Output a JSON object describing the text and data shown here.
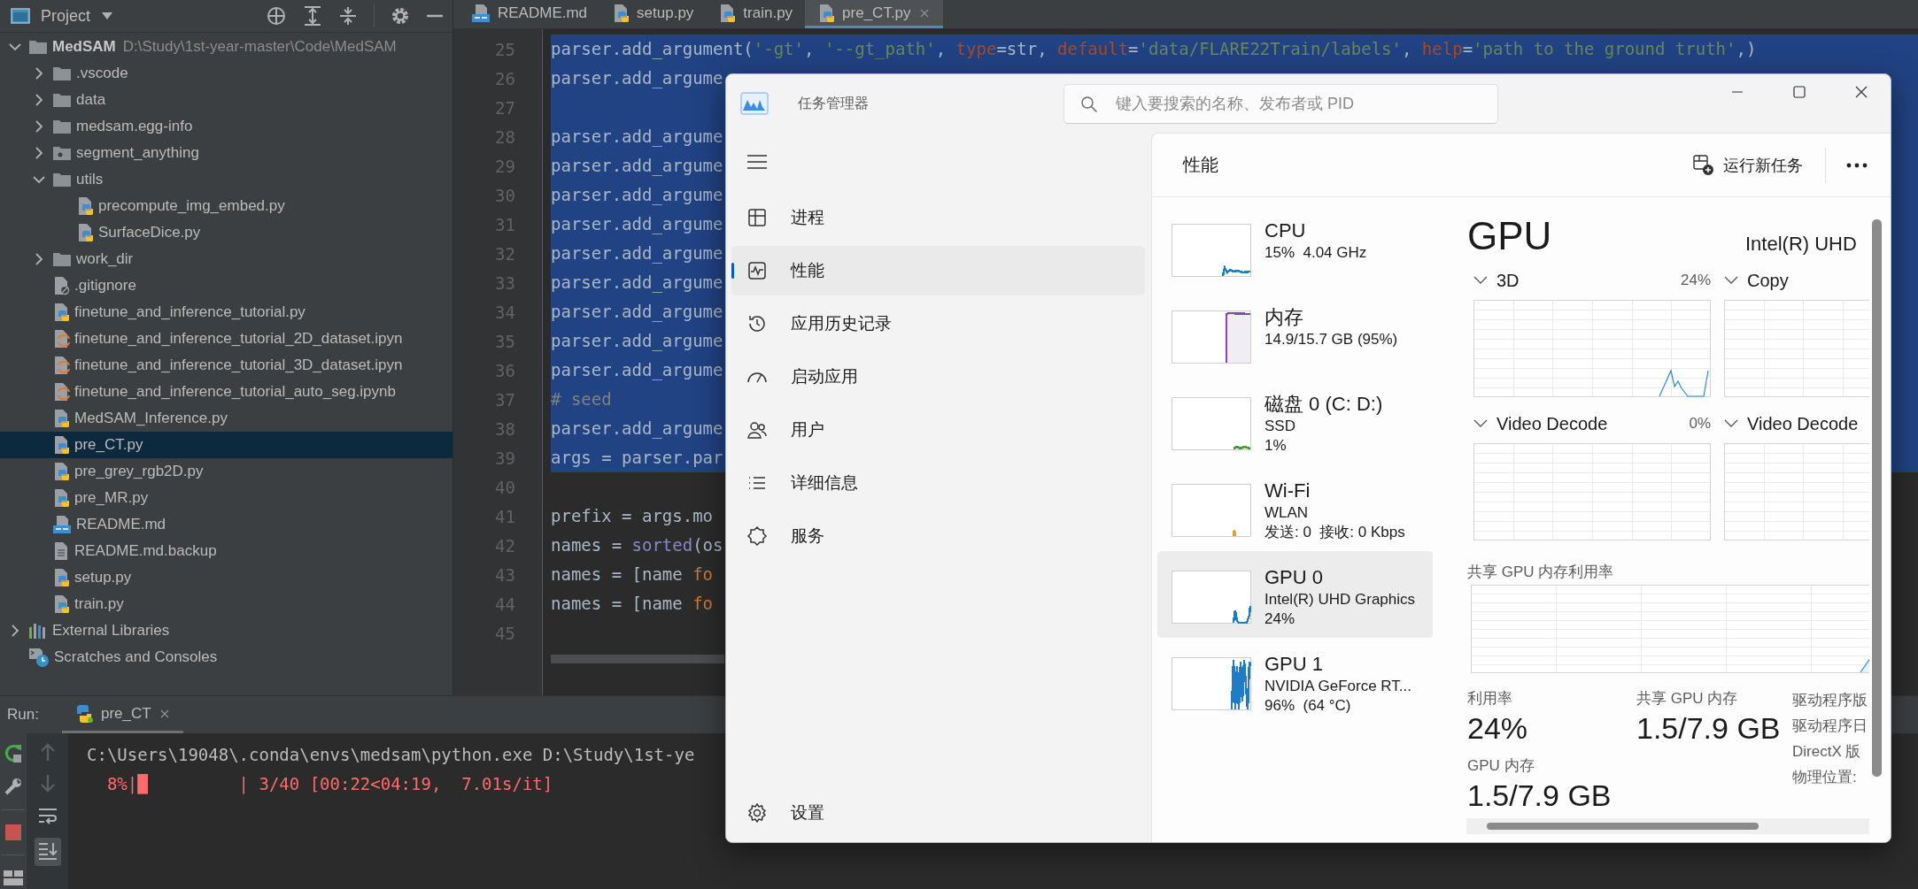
{
  "ide": {
    "project_panel": {
      "title": "Project",
      "tree": [
        {
          "label": "MedSAM",
          "path": "D:\\Study\\1st-year-master\\Code\\MedSAM",
          "kind": "folder",
          "expanded": true,
          "selected": false,
          "children": [
            {
              "label": ".vscode",
              "kind": "folder",
              "expanded": false,
              "selected": false
            },
            {
              "label": "data",
              "kind": "folder",
              "expanded": false,
              "selected": false
            },
            {
              "label": "medsam.egg-info",
              "kind": "folder",
              "expanded": false,
              "selected": false
            },
            {
              "label": "segment_anything",
              "kind": "package",
              "expanded": false,
              "selected": false
            },
            {
              "label": "utils",
              "kind": "folder",
              "expanded": true,
              "selected": false,
              "children": [
                {
                  "label": "precompute_img_embed.py",
                  "kind": "python",
                  "selected": false
                },
                {
                  "label": "SurfaceDice.py",
                  "kind": "python",
                  "selected": false
                }
              ]
            },
            {
              "label": "work_dir",
              "kind": "folder",
              "expanded": false,
              "selected": false
            },
            {
              "label": ".gitignore",
              "kind": "ignore",
              "selected": false
            },
            {
              "label": "finetune_and_inference_tutorial.py",
              "kind": "python",
              "selected": false
            },
            {
              "label": "finetune_and_inference_tutorial_2D_dataset.ipyn",
              "kind": "notebook",
              "selected": false
            },
            {
              "label": "finetune_and_inference_tutorial_3D_dataset.ipyn",
              "kind": "notebook",
              "selected": false
            },
            {
              "label": "finetune_and_inference_tutorial_auto_seg.ipynb",
              "kind": "notebook",
              "selected": false
            },
            {
              "label": "MedSAM_Inference.py",
              "kind": "python",
              "selected": false
            },
            {
              "label": "pre_CT.py",
              "kind": "python",
              "selected": true
            },
            {
              "label": "pre_grey_rgb2D.py",
              "kind": "python",
              "selected": false
            },
            {
              "label": "pre_MR.py",
              "kind": "python",
              "selected": false
            },
            {
              "label": "README.md",
              "kind": "markdown",
              "selected": false
            },
            {
              "label": "README.md.backup",
              "kind": "text",
              "selected": false
            },
            {
              "label": "setup.py",
              "kind": "python",
              "selected": false
            },
            {
              "label": "train.py",
              "kind": "python",
              "selected": false
            }
          ]
        },
        {
          "label": "External Libraries",
          "kind": "libraries",
          "expanded": false,
          "selected": false
        },
        {
          "label": "Scratches and Consoles",
          "kind": "scratches",
          "selected": false
        }
      ]
    },
    "editor": {
      "tabs": [
        {
          "label": "README.md",
          "kind": "markdown",
          "selected": false
        },
        {
          "label": "setup.py",
          "kind": "python",
          "selected": false
        },
        {
          "label": "train.py",
          "kind": "python",
          "selected": false
        },
        {
          "label": "pre_CT.py",
          "kind": "python",
          "selected": true
        }
      ],
      "lines": [
        {
          "number": "25",
          "selected": true,
          "tokens": [
            {
              "kind": "plain",
              "text": "parser.add_argument("
            },
            {
              "kind": "string",
              "text": "'-gt'"
            },
            {
              "kind": "plain",
              "text": ", "
            },
            {
              "kind": "string",
              "text": "'--gt_path'"
            },
            {
              "kind": "plain",
              "text": ", "
            },
            {
              "kind": "param",
              "text": "type"
            },
            {
              "kind": "plain",
              "text": "=str, "
            },
            {
              "kind": "param",
              "text": "default"
            },
            {
              "kind": "plain",
              "text": "="
            },
            {
              "kind": "string",
              "text": "'data/FLARE22Train/labels'"
            },
            {
              "kind": "plain",
              "text": ", "
            },
            {
              "kind": "param",
              "text": "help"
            },
            {
              "kind": "plain",
              "text": "="
            },
            {
              "kind": "string",
              "text": "'path to the ground truth'"
            },
            {
              "kind": "plain",
              "text": ",)"
            }
          ]
        },
        {
          "number": "26",
          "selected": true,
          "tokens": [
            {
              "kind": "plain",
              "text": "parser.add_argume"
            }
          ]
        },
        {
          "number": "27",
          "selected": true
        },
        {
          "number": "28",
          "selected": true,
          "tokens": [
            {
              "kind": "plain",
              "text": "parser.add_argume"
            }
          ]
        },
        {
          "number": "29",
          "selected": true,
          "tokens": [
            {
              "kind": "plain",
              "text": "parser.add_argume"
            }
          ]
        },
        {
          "number": "30",
          "selected": true,
          "tokens": [
            {
              "kind": "plain",
              "text": "parser.add_argume"
            }
          ]
        },
        {
          "number": "31",
          "selected": true,
          "tokens": [
            {
              "kind": "plain",
              "text": "parser.add_argume"
            }
          ]
        },
        {
          "number": "32",
          "selected": true,
          "tokens": [
            {
              "kind": "plain",
              "text": "parser.add_argume"
            }
          ]
        },
        {
          "number": "33",
          "selected": true,
          "tokens": [
            {
              "kind": "plain",
              "text": "parser.add_argume"
            }
          ]
        },
        {
          "number": "34",
          "selected": true,
          "tokens": [
            {
              "kind": "plain",
              "text": "parser.add_argume"
            }
          ]
        },
        {
          "number": "35",
          "selected": true,
          "tokens": [
            {
              "kind": "plain",
              "text": "parser.add_argume"
            }
          ]
        },
        {
          "number": "36",
          "selected": true,
          "tokens": [
            {
              "kind": "plain",
              "text": "parser.add_argume"
            }
          ]
        },
        {
          "number": "37",
          "selected": true,
          "tokens": [
            {
              "kind": "comment",
              "text": "# seed"
            }
          ]
        },
        {
          "number": "38",
          "selected": true,
          "tokens": [
            {
              "kind": "plain",
              "text": "parser.add_argume"
            }
          ]
        },
        {
          "number": "39",
          "selected": true,
          "tokens": [
            {
              "kind": "plain",
              "text": "args = parser.par"
            }
          ]
        },
        {
          "number": "40",
          "selected": false
        },
        {
          "number": "41",
          "selected": false,
          "tokens": [
            {
              "kind": "plain",
              "text": "prefix = args.mo"
            }
          ]
        },
        {
          "number": "42",
          "selected": false,
          "tokens": [
            {
              "kind": "plain",
              "text": "names = "
            },
            {
              "kind": "builtin",
              "text": "sorted"
            },
            {
              "kind": "plain",
              "text": "(os"
            }
          ]
        },
        {
          "number": "43",
          "selected": false,
          "tokens": [
            {
              "kind": "plain",
              "text": "names = [name "
            },
            {
              "kind": "keyword",
              "text": "fo"
            }
          ]
        },
        {
          "number": "44",
          "selected": false,
          "tokens": [
            {
              "kind": "plain",
              "text": "names = [name "
            },
            {
              "kind": "keyword",
              "text": "fo"
            }
          ]
        },
        {
          "number": "45",
          "selected": false
        }
      ]
    },
    "run_panel": {
      "label": "Run:",
      "tab": {
        "label": "pre_CT"
      },
      "console": [
        {
          "kind": "command",
          "text": "C:\\Users\\19048\\.conda\\envs\\medsam\\python.exe D:\\Study\\1st-ye"
        },
        {
          "kind": "progress",
          "text": "  8%|█         | 3/40 [00:22<04:19,  7.01s/it]"
        }
      ]
    }
  },
  "task_manager": {
    "title": "任务管理器",
    "search": {
      "placeholder": "键入要搜索的名称、发布者或 PID"
    },
    "nav": [
      {
        "label": "进程",
        "selected": false
      },
      {
        "label": "性能",
        "selected": true
      },
      {
        "label": "应用历史记录",
        "selected": false
      },
      {
        "label": "启动应用",
        "selected": false
      },
      {
        "label": "用户",
        "selected": false
      },
      {
        "label": "详细信息",
        "selected": false
      },
      {
        "label": "服务",
        "selected": false
      }
    ],
    "settings": "设置",
    "page_title": "性能",
    "run_task": "运行新任务",
    "devices": [
      {
        "name": "CPU",
        "lines": [
          "15%  4.04 GHz"
        ],
        "color": "#1f7cc5",
        "selected": false
      },
      {
        "name": "内存",
        "lines": [
          "14.9/15.7 GB (95%)"
        ],
        "color": "#8e44ad",
        "selected": false
      },
      {
        "name": "磁盘 0 (C: D:)",
        "lines": [
          "SSD",
          "1%"
        ],
        "color": "#4c9a2a",
        "selected": false
      },
      {
        "name": "Wi-Fi",
        "lines": [
          "WLAN",
          "发送: 0  接收: 0 Kbps"
        ],
        "color": "#d9a03d",
        "selected": false
      },
      {
        "name": "GPU 0",
        "lines": [
          "Intel(R) UHD Graphics",
          "24%"
        ],
        "color": "#1f7cc5",
        "selected": true
      },
      {
        "name": "GPU 1",
        "lines": [
          "NVIDIA GeForce RT...",
          "96%  (64 °C)"
        ],
        "color": "#1f7cc5",
        "selected": false
      }
    ],
    "detail": {
      "title": "GPU",
      "model": "Intel(R) UHD",
      "engines": [
        {
          "name": "3D",
          "value": "24%"
        },
        {
          "name": "Copy"
        },
        {
          "name": "Video Decode",
          "value": "0%"
        },
        {
          "name": "Video Decode"
        }
      ],
      "shared_label": "共享 GPU 内存利用率",
      "stats": [
        {
          "label": "利用率",
          "value": "24%"
        },
        {
          "label": "共享 GPU 内存",
          "value": "1.5/7.9 GB"
        },
        {
          "label": "GPU 内存",
          "value": "1.5/7.9 GB"
        }
      ],
      "properties": [
        "驱动程序版",
        "驱动程序日",
        "DirectX 版",
        "物理位置:"
      ]
    }
  }
}
